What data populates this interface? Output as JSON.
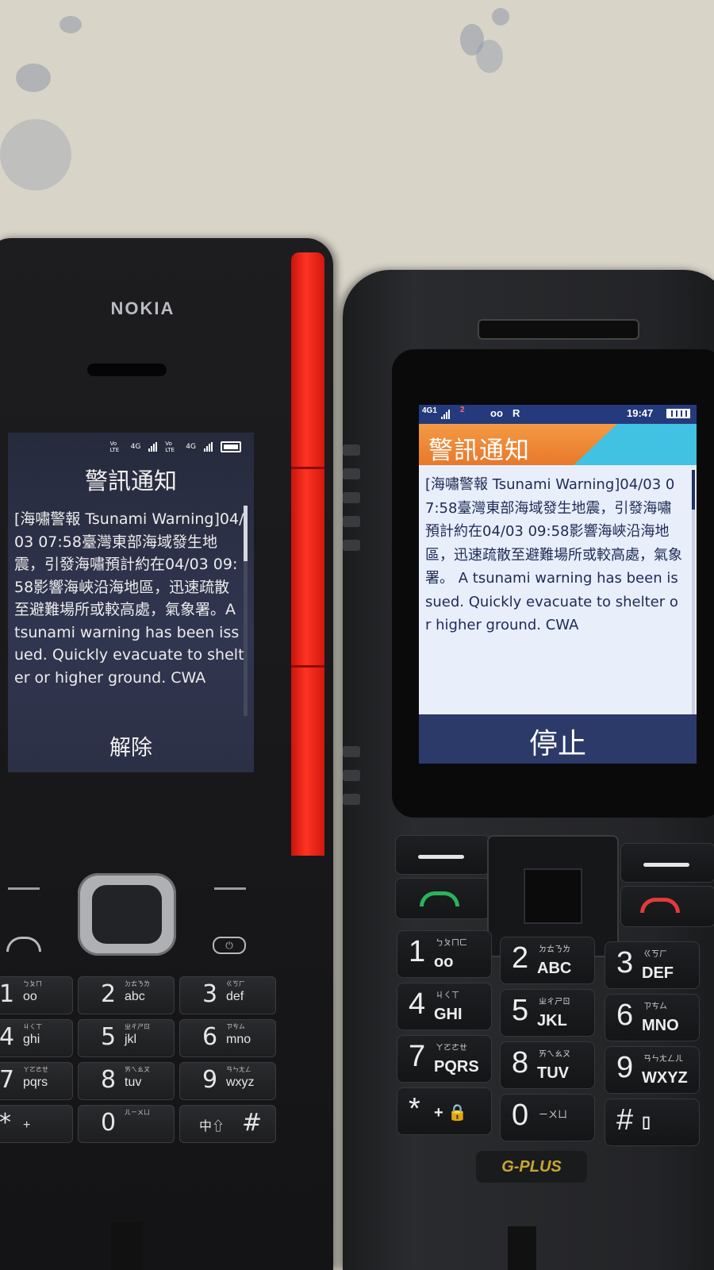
{
  "nokia": {
    "brand": "NOKIA",
    "status": {
      "volte1": "Vo LTE",
      "lte1": "4G",
      "volte2": "Vo LTE",
      "lte2": "4G"
    },
    "title": "警訊通知",
    "message": "[海嘯警報 Tsunami Warning]04/03 07:58臺灣東部海域發生地震，引發海嘯預計約在04/03 09:58影響海峽沿海地區，迅速疏散至避難場所或較高處，氣象署。A tsunami warning has been issued. Quickly evacuate to shelter or higher ground. CWA",
    "softkey": "解除",
    "keys": [
      {
        "digit": "1",
        "sub": "oo",
        "zhuyin": "ㄅㄆㄇ"
      },
      {
        "digit": "2",
        "sub": "abc",
        "zhuyin": "ㄉㄊㄋㄌ"
      },
      {
        "digit": "3",
        "sub": "def",
        "zhuyin": "ㄍㄎㄏ"
      },
      {
        "digit": "4",
        "sub": "ghi",
        "zhuyin": "ㄐㄑㄒ"
      },
      {
        "digit": "5",
        "sub": "jkl",
        "zhuyin": "ㄓㄔㄕㄖ"
      },
      {
        "digit": "6",
        "sub": "mno",
        "zhuyin": "ㄗㄘㄙ"
      },
      {
        "digit": "7",
        "sub": "pqrs",
        "zhuyin": "ㄚㄛㄜㄝ"
      },
      {
        "digit": "8",
        "sub": "tuv",
        "zhuyin": "ㄞㄟㄠㄡ"
      },
      {
        "digit": "9",
        "sub": "wxyz",
        "zhuyin": "ㄢㄣㄤㄥ"
      },
      {
        "digit": "*",
        "sub": "+",
        "zhuyin": ""
      },
      {
        "digit": "0",
        "sub": "",
        "zhuyin": "ㄦㄧㄨㄩ"
      },
      {
        "digit": "#",
        "sub": "中⇧",
        "zhuyin": ""
      }
    ]
  },
  "gplus": {
    "brand": "G-PLUS",
    "status": {
      "network": "4G1",
      "sim2": "2",
      "voicemail": "oo",
      "roaming": "R",
      "time": "19:47"
    },
    "title": "警訊通知",
    "message": "[海嘯警報 Tsunami Warning]04/03 07:58臺灣東部海域發生地震，引發海嘯預計約在04/03 09:58影響海峽沿海地區，迅速疏散至避難場所或較高處，氣象署。 A tsunami warning has been issued. Quickly evacuate to shelter or higher ground. CWA",
    "softkey": "停止",
    "keys": [
      {
        "digit": "1",
        "sub": "oo",
        "zhuyin": "ㄅㄆㄇㄈ"
      },
      {
        "digit": "2",
        "sub": "ABC",
        "zhuyin": "ㄉㄊㄋㄌ"
      },
      {
        "digit": "3",
        "sub": "DEF",
        "zhuyin": "ㄍㄎㄏ"
      },
      {
        "digit": "4",
        "sub": "GHI",
        "zhuyin": "ㄐㄑㄒ"
      },
      {
        "digit": "5",
        "sub": "JKL",
        "zhuyin": "ㄓㄔㄕㄖ"
      },
      {
        "digit": "6",
        "sub": "MNO",
        "zhuyin": "ㄗㄘㄙ"
      },
      {
        "digit": "7",
        "sub": "PQRS",
        "zhuyin": "ㄚㄛㄜㄝ"
      },
      {
        "digit": "8",
        "sub": "TUV",
        "zhuyin": "ㄞㄟㄠㄡ"
      },
      {
        "digit": "9",
        "sub": "WXYZ",
        "zhuyin": "ㄢㄣㄤㄥㄦ"
      },
      {
        "digit": "*",
        "sub": "+ 🔒",
        "zhuyin": ""
      },
      {
        "digit": "0",
        "sub": "",
        "zhuyin": "ㄧㄨㄩ"
      },
      {
        "digit": "#",
        "sub": "▯",
        "zhuyin": ""
      }
    ]
  },
  "colors": {
    "nokia_red": "#ff3322",
    "gplus_header_orange": "#e8782a",
    "gplus_header_cyan": "#41c2e2",
    "gplus_status_blue": "#253a7c"
  }
}
